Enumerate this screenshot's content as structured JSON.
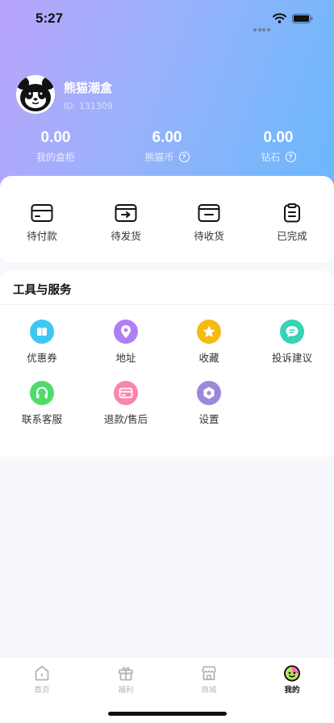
{
  "status_bar": {
    "time": "5:27"
  },
  "profile": {
    "name": "熊猫潮盒",
    "id_text": "ID: 131309",
    "avatar_icon": "panda-avatar"
  },
  "stats": [
    {
      "value": "0.00",
      "label": "我的盒柜",
      "has_help": false
    },
    {
      "value": "6.00",
      "label": "熊猫币",
      "has_help": true
    },
    {
      "value": "0.00",
      "label": "钻石",
      "has_help": true
    }
  ],
  "orders": [
    {
      "label": "待付款",
      "icon": "card-icon"
    },
    {
      "label": "待发货",
      "icon": "shipping-icon"
    },
    {
      "label": "待收货",
      "icon": "wallet-icon"
    },
    {
      "label": "已完成",
      "icon": "clipboard-icon"
    }
  ],
  "tools": {
    "title": "工具与服务",
    "items": [
      {
        "label": "优惠券",
        "icon": "coupon-icon",
        "color": "#3ec7f4"
      },
      {
        "label": "地址",
        "icon": "location-icon",
        "color": "#b07ff4"
      },
      {
        "label": "收藏",
        "icon": "star-icon",
        "color": "#f7ba12"
      },
      {
        "label": "投诉建议",
        "icon": "feedback-icon",
        "color": "#36d3b6"
      },
      {
        "label": "联系客服",
        "icon": "headset-icon",
        "color": "#4fdc6a"
      },
      {
        "label": "退款/售后",
        "icon": "refund-card-icon",
        "color": "#f986ad"
      },
      {
        "label": "设置",
        "icon": "settings-icon",
        "color": "#9d87dd"
      }
    ]
  },
  "tabbar": [
    {
      "label": "首页",
      "icon": "home-icon",
      "active": false
    },
    {
      "label": "福利",
      "icon": "gift-icon",
      "active": false
    },
    {
      "label": "商城",
      "icon": "store-icon",
      "active": false
    },
    {
      "label": "我的",
      "icon": "profile-face-icon",
      "active": true
    }
  ],
  "colors": {
    "hero_start": "#b9a4fb",
    "hero_end": "#69b8fb",
    "background": "#f7f8fc"
  }
}
